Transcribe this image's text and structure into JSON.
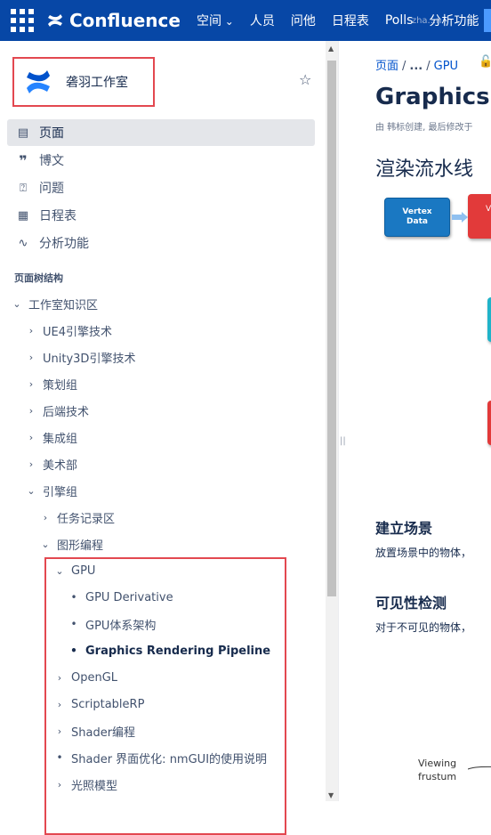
{
  "topbar": {
    "brand": "Confluence",
    "nav": [
      {
        "label": "空间",
        "dropdown": true
      },
      {
        "label": "人员",
        "dropdown": false
      },
      {
        "label": "问他",
        "dropdown": false
      },
      {
        "label": "日程表",
        "dropdown": false
      },
      {
        "label": "Polls",
        "dropdown": false,
        "overlay": "zha...n"
      },
      {
        "label": "分析功能",
        "dropdown": false
      }
    ],
    "colors": {
      "bar": "#0747a6",
      "accent": "#4c9aff"
    }
  },
  "space": {
    "name": "砻羽工作室",
    "logo": "confluence-logo-icon"
  },
  "sidebar_menu": [
    {
      "label": "页面",
      "icon": "page-icon",
      "active": true
    },
    {
      "label": "博文",
      "icon": "quote-icon",
      "active": false
    },
    {
      "label": "问题",
      "icon": "question-icon",
      "active": false
    },
    {
      "label": "日程表",
      "icon": "calendar-icon",
      "active": false
    },
    {
      "label": "分析功能",
      "icon": "analytics-icon",
      "active": false
    }
  ],
  "tree": {
    "title": "页面树结构",
    "items": [
      {
        "label": "工作室知识区",
        "level": 0,
        "kind": "expanded"
      },
      {
        "label": "UE4引擎技术",
        "level": 1,
        "kind": "collapsed"
      },
      {
        "label": "Unity3D引擎技术",
        "level": 1,
        "kind": "collapsed"
      },
      {
        "label": "策划组",
        "level": 1,
        "kind": "collapsed"
      },
      {
        "label": "后端技术",
        "level": 1,
        "kind": "collapsed"
      },
      {
        "label": "集成组",
        "level": 1,
        "kind": "collapsed"
      },
      {
        "label": "美术部",
        "level": 1,
        "kind": "collapsed"
      },
      {
        "label": "引擎组",
        "level": 1,
        "kind": "expanded"
      },
      {
        "label": "任务记录区",
        "level": 2,
        "kind": "collapsed"
      },
      {
        "label": "图形编程",
        "level": 2,
        "kind": "expanded"
      },
      {
        "label": "GPU",
        "level": 3,
        "kind": "expanded"
      },
      {
        "label": "GPU Derivative",
        "level": 4,
        "kind": "leaf"
      },
      {
        "label": "GPU体系架构",
        "level": 4,
        "kind": "leaf"
      },
      {
        "label": "Graphics Rendering Pipeline",
        "level": 4,
        "kind": "leaf",
        "current": true
      },
      {
        "label": "OpenGL",
        "level": 3,
        "kind": "collapsed"
      },
      {
        "label": "ScriptableRP",
        "level": 3,
        "kind": "collapsed"
      },
      {
        "label": "Shader编程",
        "level": 3,
        "kind": "collapsed"
      },
      {
        "label": "Shader 界面优化: nmGUI的使用说明",
        "level": 3,
        "kind": "leaf"
      },
      {
        "label": "光照模型",
        "level": 3,
        "kind": "collapsed"
      }
    ]
  },
  "content": {
    "breadcrumb": [
      "页面",
      "...",
      "GPU"
    ],
    "title": "Graphics R",
    "byline": "由 韩标创建, 最后修改于",
    "section_title": "渲染流水线",
    "diagram": {
      "vertex_label_1": "Vertex",
      "vertex_label_2": "Data",
      "partial_label": "V s"
    },
    "sections": [
      {
        "heading": "建立场景",
        "text": "放置场景中的物体，"
      },
      {
        "heading": "可见性检测",
        "text": "对于不可见的物体，"
      }
    ],
    "frustum_label_1": "Viewing",
    "frustum_label_2": "frustum"
  }
}
